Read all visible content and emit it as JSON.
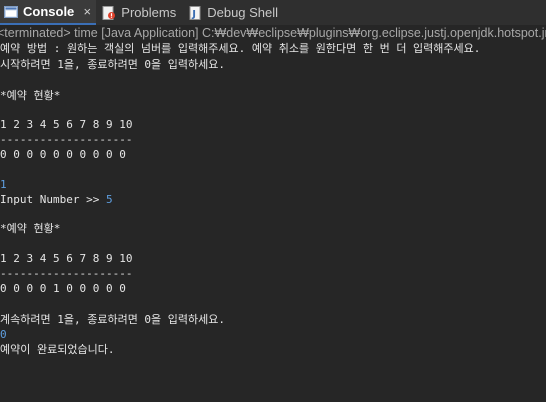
{
  "tabs": [
    {
      "label": "Console",
      "close": "×",
      "icon": "console-icon",
      "active": true
    },
    {
      "label": "Problems",
      "icon": "problems-icon",
      "active": false
    },
    {
      "label": "Debug Shell",
      "icon": "debug-shell-icon",
      "active": false
    }
  ],
  "status": "<terminated> time [Java Application] C:₩dev₩eclipse₩plugins₩org.eclipse.justj.openjdk.hotspot.jre.full",
  "console": {
    "lines": [
      "예약 방법 : 원하는 객실의 넘버를 입력해주세요. 예약 취소를 원한다면 한 번 더 입력해주세요.",
      "시작하려면 1을, 종료하려면 0을 입력하세요.",
      "*예약 현황*",
      "1 2 3 4 5 6 7 8 9 10",
      "--------------------",
      "0 0 0 0 0 0 0 0 0 0",
      "1",
      "Input Number >> ",
      "5",
      "*예약 현황*",
      "1 2 3 4 5 6 7 8 9 10",
      "--------------------",
      "0 0 0 0 1 0 0 0 0 0",
      "계속하려면 1을, 종료하려면 0을 입력하세요.",
      "0",
      "예약이 완료되었습니다."
    ]
  },
  "colors": {
    "background": "#262626",
    "tabbar": "#2f2f2f",
    "text": "#e6e6e6",
    "input": "#5f9fe0",
    "status_text": "#a8a8a8"
  }
}
